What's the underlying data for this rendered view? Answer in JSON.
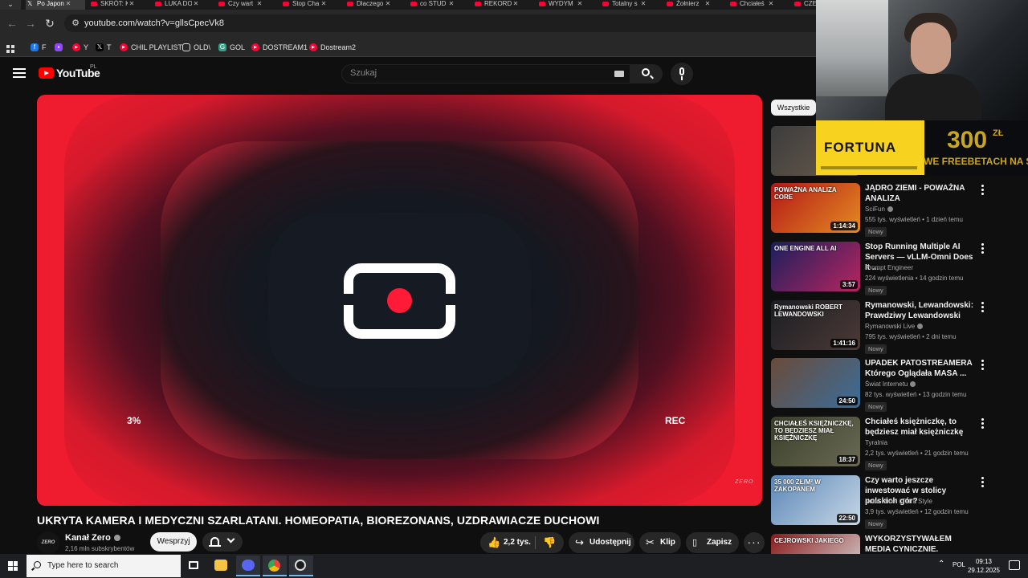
{
  "browser": {
    "tabs": [
      {
        "label": "Po Japon",
        "icon": "x-icon"
      },
      {
        "label": "SKRÓT: K",
        "icon": "youtube-icon"
      },
      {
        "label": "LUKA DO",
        "icon": "youtube-icon"
      },
      {
        "label": "Czy wart",
        "icon": "youtube-icon"
      },
      {
        "label": "Stop Cha",
        "icon": "youtube-icon"
      },
      {
        "label": "Dlaczego",
        "icon": "youtube-icon"
      },
      {
        "label": "co STUD",
        "icon": "youtube-icon"
      },
      {
        "label": "REKORD",
        "icon": "youtube-icon"
      },
      {
        "label": "WYDYM",
        "icon": "youtube-icon"
      },
      {
        "label": "Totalny s",
        "icon": "youtube-icon"
      },
      {
        "label": "Żołnierz",
        "icon": "youtube-icon"
      },
      {
        "label": "Chciałeś",
        "icon": "youtube-icon"
      },
      {
        "label": "CZE",
        "icon": "youtube-icon"
      }
    ],
    "tab_close_glyph": "✕",
    "tab_menu_glyph": "⌄",
    "url": "youtube.com/watch?v=gllsCpecVk8",
    "bookmarks": [
      {
        "label": "F",
        "icon": "facebook-icon",
        "color": "#1877f2"
      },
      {
        "label": "",
        "icon": "twitch-icon",
        "color": "#9146ff"
      },
      {
        "label": "Y",
        "icon": "youtube-icon",
        "color": "#ff0033"
      },
      {
        "label": "T",
        "icon": "x-icon",
        "color": "#000000"
      },
      {
        "label": "CHIL PLAYLIST",
        "icon": "youtube-icon",
        "color": "#ff0033"
      },
      {
        "label": "OLD\\",
        "icon": "folder-icon",
        "color": "#282828"
      },
      {
        "label": "GOL",
        "icon": "g-icon",
        "color": "#2fa38a"
      },
      {
        "label": "DOSTREAM1",
        "icon": "youtube-icon",
        "color": "#ff0033"
      },
      {
        "label": "Dostream2",
        "icon": "youtube-icon",
        "color": "#ff0033"
      }
    ]
  },
  "youtube": {
    "logo_text": "YouTube",
    "country_code": "PL",
    "search_placeholder": "Szukaj",
    "video": {
      "overlay_left": "3%",
      "overlay_right": "REC",
      "watermark": "ZERO",
      "title": "UKRYTA KAMERA I MEDYCZNI SZARLATANI. HOMEOPATIA, BIOREZONANS, UZDRAWIACZE DUCHOWI"
    },
    "channel": {
      "avatar_text": "ZERO",
      "name": "Kanał Zero",
      "subscribers": "2,16 mln subskrybentów",
      "support_label": "Wesprzyj"
    },
    "actions": {
      "likes": "2,2 tys.",
      "share": "Udostępnij",
      "clip": "Klip",
      "save": "Zapisz"
    },
    "filter_chip": "Wszystkie",
    "recommendations": [
      {
        "title": "JĄDRO ZIEMI - POWAŻNA ANALIZA",
        "channel": "SciFun",
        "verified": true,
        "meta": "555 tys. wyświetleń • 1 dzień temu",
        "badge": "Nowy",
        "duration": "1:14:34",
        "thumb_text": "POWAŻNA ANALIZA CORE",
        "colors": [
          "#b31818",
          "#e58b22"
        ]
      },
      {
        "title": "Stop Running Multiple AI Servers — vLLM-Omni Does It ...",
        "channel": "Prompt Engineer",
        "verified": false,
        "meta": "224 wyświetlenia • 14 godzin temu",
        "badge": "Nowy",
        "duration": "3:57",
        "thumb_text": "ONE ENGINE ALL AI",
        "colors": [
          "#1a1f5e",
          "#b8255f"
        ]
      },
      {
        "title": "Rymanowski, Lewandowski: Prawdziwy Lewandowski",
        "channel": "Rymanowski Live",
        "verified": true,
        "meta": "795 tys. wyświetleń • 2 dni temu",
        "badge": "Nowy",
        "duration": "1:41:16",
        "thumb_text": "Rymanowski ROBERT LEWANDOWSKI",
        "colors": [
          "#1c1e24",
          "#4b3a35"
        ]
      },
      {
        "title": "UPADEK PATOSTREAMERA Którego Oglądała MASA ...",
        "channel": "Świat Internetu",
        "verified": true,
        "meta": "82 tys. wyświetleń • 13 godzin temu",
        "badge": "Nowy",
        "duration": "24:50",
        "thumb_text": "",
        "colors": [
          "#6a4b3a",
          "#3b6d9a"
        ]
      },
      {
        "title": "Chciałeś księżniczkę, to będziesz miał księżniczkę",
        "channel": "Tyralnia",
        "verified": false,
        "meta": "2,2 tys. wyświetleń • 21 godzin temu",
        "badge": "Nowy",
        "duration": "18:37",
        "thumb_text": "CHCIAŁEŚ KSIĘŻNICZKĘ, TO BĘDZIESZ MIAŁ KSIĘŻNICZKĘ",
        "colors": [
          "#3a3f2a",
          "#6a6a55"
        ]
      },
      {
        "title": "Czy warto jeszcze inwestować w stolicy polskich gór?",
        "channel": "Kuba Midel i Tatra Style",
        "verified": false,
        "meta": "3,9 tys. wyświetleń • 12 godzin temu",
        "badge": "Nowy",
        "duration": "22:50",
        "thumb_text": "35 000 ZŁ/M² W ZAKOPANEM",
        "colors": [
          "#5b87b7",
          "#c7d7e6"
        ]
      },
      {
        "title": "WYKORZYSTYWAŁEM MEDIA CYNICZNIE. WOJCIECH ...",
        "channel": "",
        "verified": false,
        "meta": "",
        "badge": "",
        "duration": "",
        "thumb_text": "CEJROWSKI JAKIEGO",
        "colors": [
          "#8a1c1c",
          "#d9d9d9"
        ]
      }
    ]
  },
  "ad": {
    "brand": "FORTUNA",
    "amount": "300",
    "currency": "ZŁ",
    "promo": "WE FREEBETACH NA START"
  },
  "taskbar": {
    "search_placeholder": "Type here to search",
    "language": "POL",
    "time": "09:13",
    "date": "29.12.2025",
    "apps": [
      "task-view-icon",
      "file-explorer-icon",
      "discord-icon",
      "chrome-icon",
      "obs-icon"
    ]
  }
}
